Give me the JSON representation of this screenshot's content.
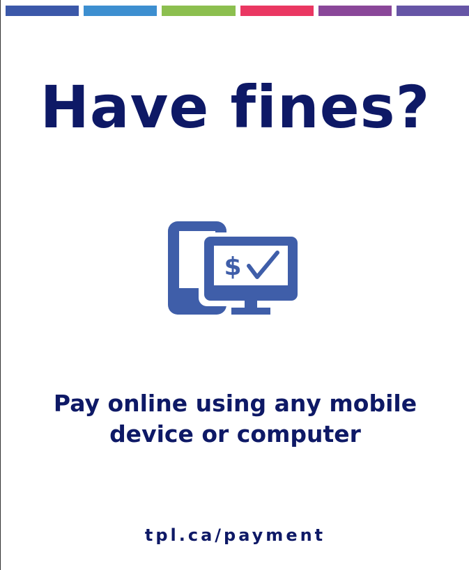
{
  "stripes": [
    {
      "color": "#3b58a9"
    },
    {
      "color": "#3d8fd0"
    },
    {
      "color": "#8cbf4f"
    },
    {
      "color": "#ea3762"
    },
    {
      "color": "#8a4799"
    },
    {
      "color": "#6655a6"
    }
  ],
  "title": "Have fines?",
  "icon": {
    "name": "mobile-and-computer-payment-icon",
    "symbol": "$",
    "color": "#3f5ea9"
  },
  "tagline": {
    "line1": "Pay online using any mobile",
    "line2": "device or computer"
  },
  "url": "tpl.ca/payment",
  "colors": {
    "text": "#0e1966",
    "background": "#ffffff"
  }
}
